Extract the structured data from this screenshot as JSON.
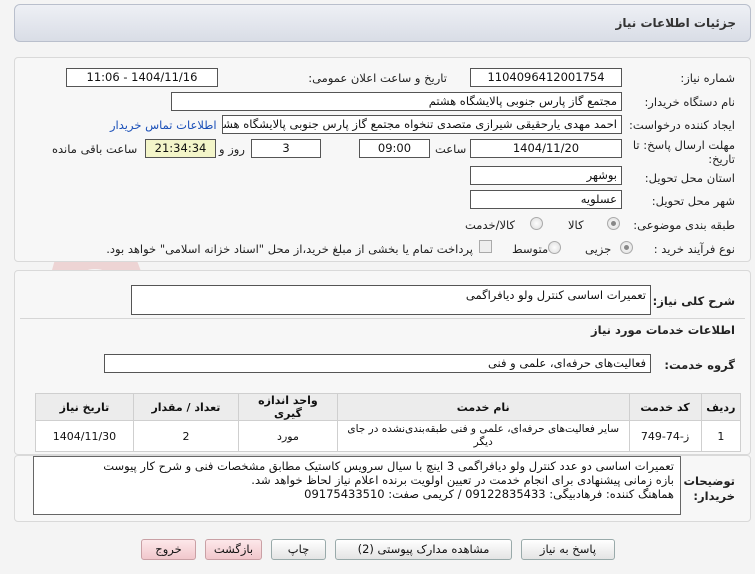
{
  "header": {
    "title": "جزئیات اطلاعات نیاز"
  },
  "form": {
    "need_number_label": "شماره نیاز:",
    "need_number": "1104096412001754",
    "announce_label": "تاریخ و ساعت اعلان عمومی:",
    "announce_value": "1404/11/16 - 11:06",
    "buyer_org_label": "نام دستگاه خریدار:",
    "buyer_org": "مجتمع گاز پارس جنوبی  پالایشگاه هشتم",
    "creator_label": "ایجاد کننده درخواست:",
    "creator": "احمد مهدی یارحقیقی شیرازی متصدی تنخواه مجتمع گاز پارس جنوبی  پالایشگاه هشتم",
    "contact_link": "اطلاعات تماس خریدار",
    "deadline_label_1": "مهلت ارسال پاسخ: تا",
    "deadline_label_2": "تاریخ:",
    "deadline_date": "1404/11/20",
    "time_label": "ساعت",
    "deadline_time": "09:00",
    "days_value": "3",
    "days_label": "روز و",
    "remaining_time": "21:34:34",
    "remaining_label": "ساعت باقی مانده",
    "province_label": "استان محل تحویل:",
    "province": "بوشهر",
    "city_label": "شهر محل تحویل:",
    "city": "عسلویه",
    "category_label": "طبقه بندی موضوعی:",
    "category_options": [
      "کالا",
      "کالا/خدمت"
    ],
    "process_label": "نوع فرآیند خرید :",
    "process_options": [
      "جزیی",
      "متوسط"
    ],
    "process_note": "پرداخت تمام یا بخشی از مبلغ خرید،از محل \"اسناد خزانه اسلامی\" خواهد بود."
  },
  "summary": {
    "label": "شرح کلی نیاز:",
    "value": "تعمیرات اساسی کنترل ولو دیافراگمی"
  },
  "services": {
    "section_title": "اطلاعات خدمات مورد نیاز",
    "group_label": "گروه خدمت:",
    "group_value": "فعالیت‌های حرفه‌ای، علمی و فنی",
    "columns": [
      "ردیف",
      "کد خدمت",
      "نام خدمت",
      "واحد اندازه گیری",
      "تعداد / مقدار",
      "تاریخ نیاز"
    ],
    "rows": [
      [
        "1",
        "ز-74-749",
        "سایر فعالیت‌های حرفه‌ای، علمی و فنی طبقه‌بندی‌نشده در جای دیگر",
        "مورد",
        "2",
        "1404/11/30"
      ]
    ]
  },
  "notes": {
    "label_1": "توضیحات",
    "label_2": "خریدار:",
    "text": "تعمیرات اساسی دو عدد کنترل ولو دیافراگمی 3 اینچ با سیال سرویس کاستیک مطابق مشخصات فنی و شرح کار پیوست\nبازه زمانی پیشنهادی برای انجام خدمت در تعیین اولویت برنده اعلام نیاز لحاظ خواهد شد.\nهماهنگ کننده: فرهادبیگی: 09122835433 / کریمی صفت: 09175433510"
  },
  "buttons": {
    "reply": "پاسخ به نیاز",
    "attachments": "مشاهده مدارک پیوستی (2)",
    "print": "چاپ",
    "back": "بازگشت",
    "exit": "خروج"
  }
}
